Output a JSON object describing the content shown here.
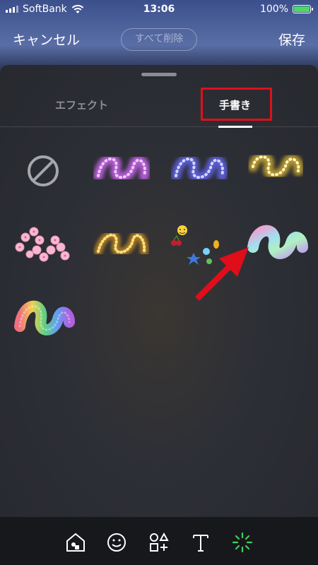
{
  "status_bar": {
    "carrier": "SoftBank",
    "time": "13:06",
    "battery": "100%"
  },
  "nav": {
    "cancel": "キャンセル",
    "clear_all": "すべて削除",
    "save": "保存"
  },
  "tabs": {
    "effect": "エフェクト",
    "handwriting": "手書き",
    "selected": "handwriting"
  },
  "brushes": [
    {
      "name": "none",
      "icon": "prohibited-icon"
    },
    {
      "name": "pink-sparkle",
      "color": "#d68cf0"
    },
    {
      "name": "blue-sparkle",
      "color": "#8c8cf5"
    },
    {
      "name": "gold-sparkle",
      "color": "#e8d05a",
      "highlighted": true
    },
    {
      "name": "sakura-flowers",
      "color": "#f5b8d0"
    },
    {
      "name": "gold-glitter",
      "color": "#e0b040"
    },
    {
      "name": "emoji-stickers",
      "color": "#ffcc33"
    },
    {
      "name": "holographic",
      "color": "#a0d8f0"
    },
    {
      "name": "rainbow-glitter",
      "color": "#e07090"
    }
  ],
  "toolbar": [
    "home-shape-icon",
    "smiley-icon",
    "shapes-icon",
    "text-icon",
    "sparkle-brush-icon"
  ]
}
